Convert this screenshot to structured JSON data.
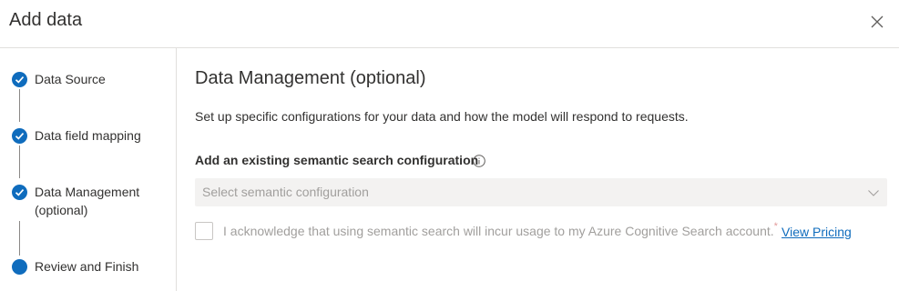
{
  "dialog": {
    "title": "Add data"
  },
  "steps": [
    {
      "label": "Data Source",
      "status": "completed"
    },
    {
      "label": "Data field mapping",
      "status": "completed"
    },
    {
      "label_line1": "Data Management",
      "label_line2": "(optional)",
      "status": "completed"
    },
    {
      "label": "Review and Finish",
      "status": "current"
    }
  ],
  "main": {
    "title": "Data Management (optional)",
    "description": "Set up specific configurations for your data and how the model will respond to requests.",
    "semantic_label": "Add an existing semantic search configuration",
    "dropdown_placeholder": "Select semantic configuration",
    "acknowledge_text": "I acknowledge that using semantic search will incur usage to my Azure Cognitive Search account.",
    "required_mark": "*",
    "view_pricing": "View Pricing",
    "acknowledge_checked": false
  },
  "icons": {
    "close": "close-icon",
    "check": "checkmark-icon",
    "info": "info-icon",
    "chevron": "chevron-down-icon"
  },
  "colors": {
    "accent": "#0f6cbd",
    "disabled_text": "#a19f9d",
    "required": "#e39b9b"
  }
}
